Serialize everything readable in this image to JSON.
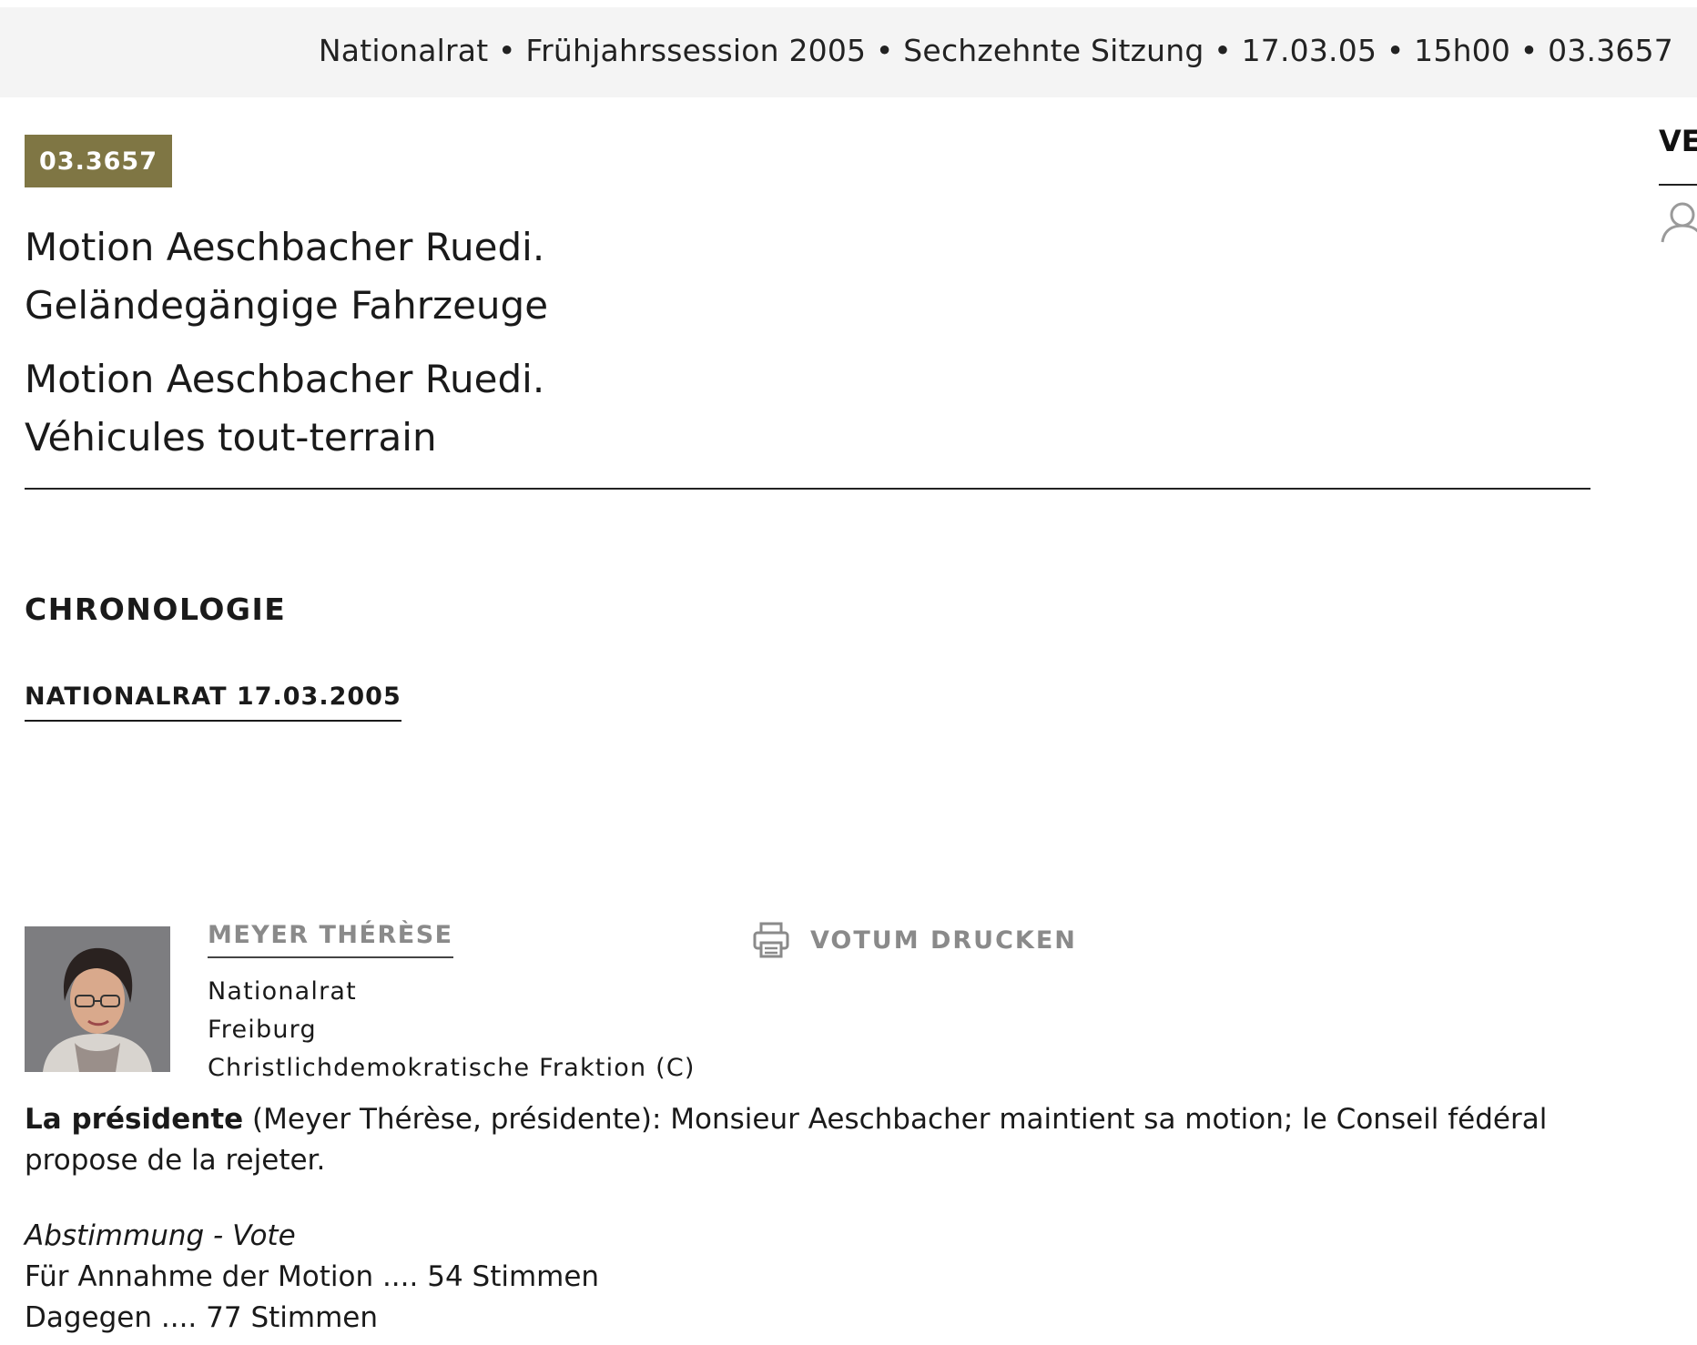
{
  "header": {
    "breadcrumb": "Nationalrat • Frühjahrssession 2005 • Sechzehnte Sitzung • 17.03.05 • 15h00 • 03.3657"
  },
  "business": {
    "number": "03.3657",
    "title_de_line1": "Motion Aeschbacher Ruedi.",
    "title_de_line2": "Geländegängige Fahrzeuge",
    "title_fr_line1": "Motion Aeschbacher Ruedi.",
    "title_fr_line2": "Véhicules tout-terrain"
  },
  "sidebar": {
    "label_partial": "VE",
    "icon": "person-icon"
  },
  "chronology": {
    "heading": "CHRONOLOGIE",
    "entry_label": "NATIONALRAT 17.03.2005"
  },
  "speaker": {
    "name": "MEYER THÉRÈSE",
    "council": "Nationalrat",
    "canton": "Freiburg",
    "group": "Christlichdemokratische Fraktion (C)",
    "photo_icon": "speaker-photo",
    "print_label": "VOTUM DRUCKEN",
    "print_icon": "printer-icon"
  },
  "statement": {
    "role": "La présidente",
    "text": " (Meyer Thérèse, présidente): Monsieur Aeschbacher maintient sa motion; le Conseil fédéral propose de la rejeter."
  },
  "vote": {
    "title": "Abstimmung - Vote",
    "for_line": "Für Annahme der Motion .... 54 Stimmen",
    "against_line": "Dagegen .... 77 Stimmen"
  },
  "colors": {
    "badge_bg": "#7f7644",
    "topbar_bg": "#f4f4f4",
    "muted_text": "#8a8a8a"
  }
}
